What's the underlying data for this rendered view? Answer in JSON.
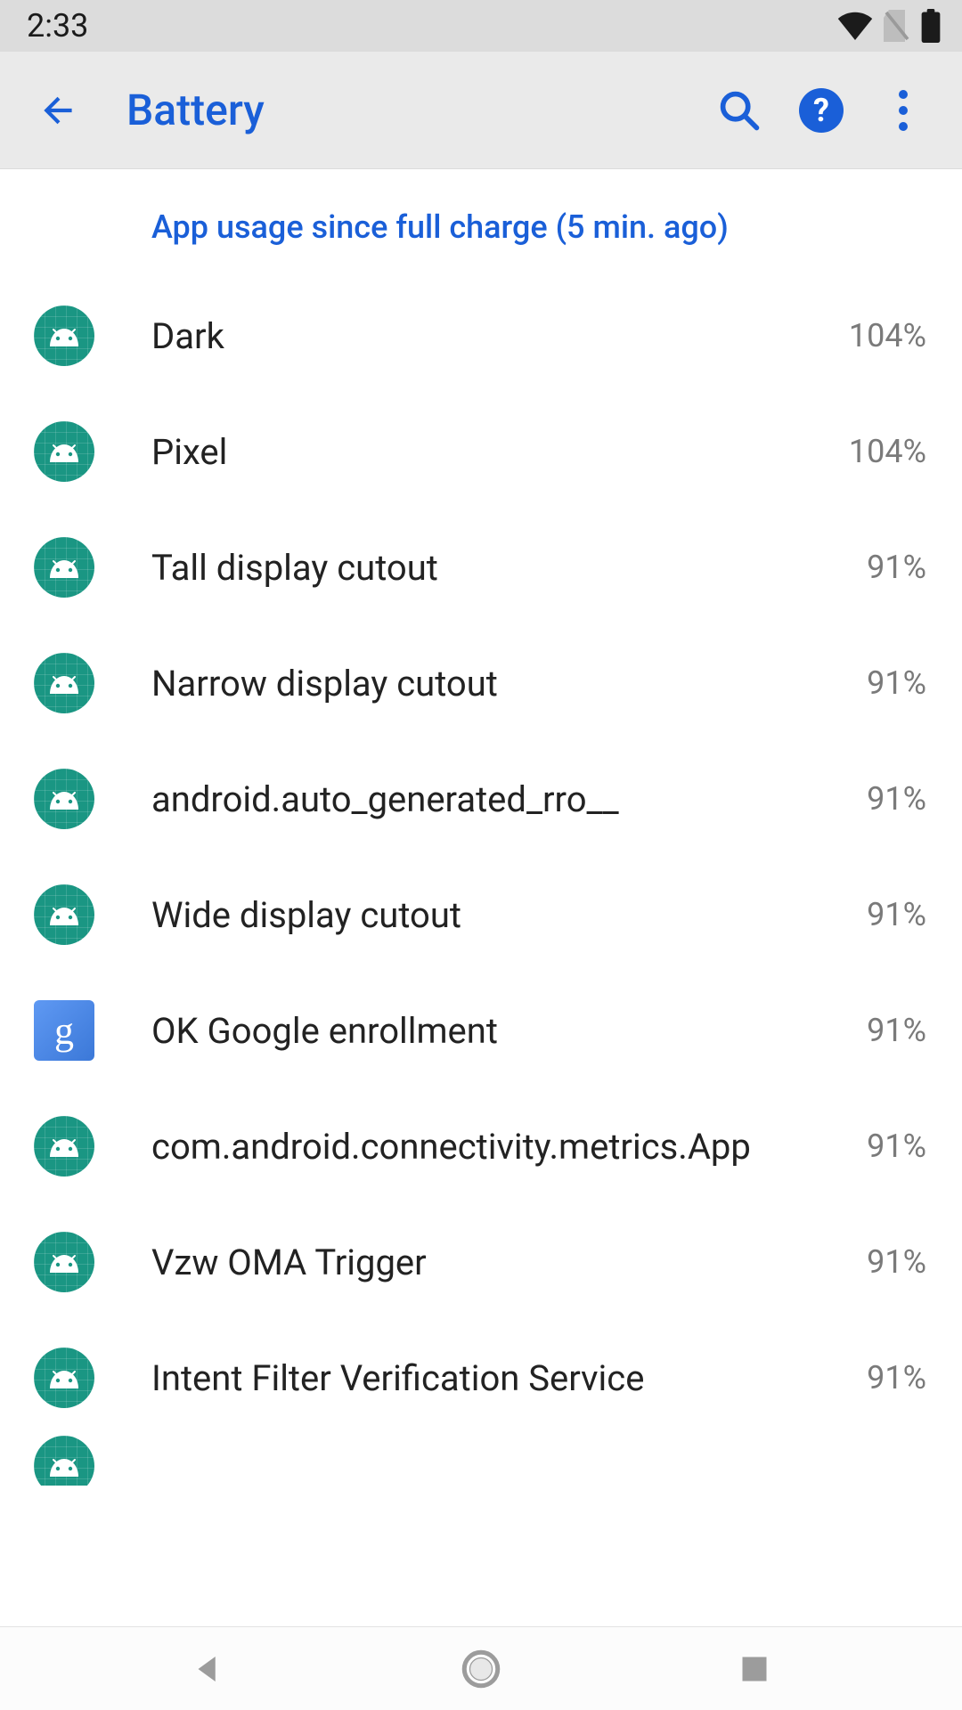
{
  "status": {
    "time": "2:33"
  },
  "appbar": {
    "title": "Battery"
  },
  "section_header": "App usage since full charge (5 min. ago)",
  "apps": [
    {
      "name": "Dark",
      "percent": "104%",
      "icon": "android"
    },
    {
      "name": "Pixel",
      "percent": "104%",
      "icon": "android"
    },
    {
      "name": "Tall display cutout",
      "percent": "91%",
      "icon": "android"
    },
    {
      "name": "Narrow display cutout",
      "percent": "91%",
      "icon": "android"
    },
    {
      "name": "android.auto_generated_rro__",
      "percent": "91%",
      "icon": "android"
    },
    {
      "name": "Wide display cutout",
      "percent": "91%",
      "icon": "android"
    },
    {
      "name": "OK Google enrollment",
      "percent": "91%",
      "icon": "google"
    },
    {
      "name": "com.android.connectivity.metrics.App",
      "percent": "91%",
      "icon": "android"
    },
    {
      "name": "Vzw OMA Trigger",
      "percent": "91%",
      "icon": "android"
    },
    {
      "name": "Intent Filter Verification Service",
      "percent": "91%",
      "icon": "android"
    }
  ],
  "colors": {
    "accent": "#1a5fd8",
    "android_icon_bg": "#1a9683",
    "status_bg": "#dcdcdc",
    "appbar_bg": "#eaeaea"
  }
}
